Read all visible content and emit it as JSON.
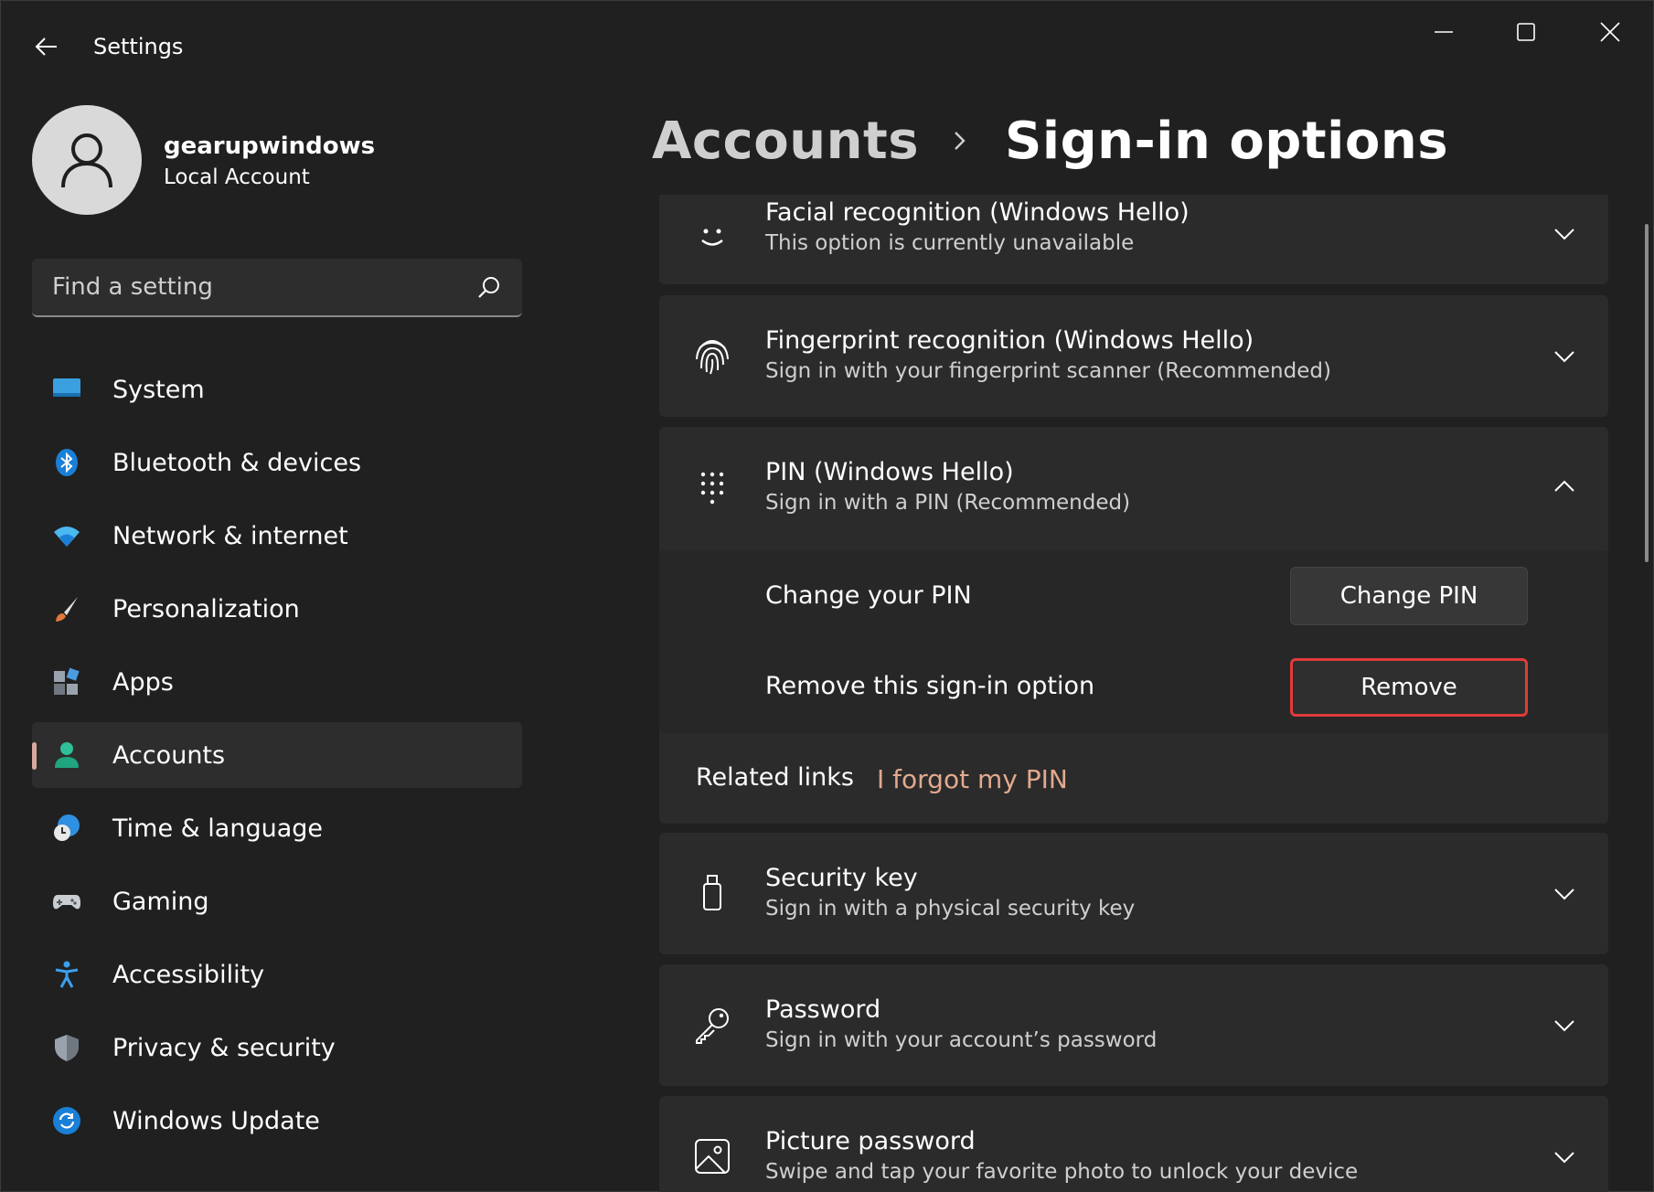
{
  "window": {
    "title": "Settings"
  },
  "user": {
    "name": "gearupwindows",
    "account_type": "Local Account"
  },
  "search": {
    "placeholder": "Find a setting"
  },
  "nav": {
    "items": [
      {
        "label": "System",
        "icon": "system-icon",
        "active": false
      },
      {
        "label": "Bluetooth & devices",
        "icon": "bluetooth-icon",
        "active": false
      },
      {
        "label": "Network & internet",
        "icon": "wifi-icon",
        "active": false
      },
      {
        "label": "Personalization",
        "icon": "brush-icon",
        "active": false
      },
      {
        "label": "Apps",
        "icon": "apps-icon",
        "active": false
      },
      {
        "label": "Accounts",
        "icon": "accounts-icon",
        "active": true
      },
      {
        "label": "Time & language",
        "icon": "time-language-icon",
        "active": false
      },
      {
        "label": "Gaming",
        "icon": "gamepad-icon",
        "active": false
      },
      {
        "label": "Accessibility",
        "icon": "accessibility-icon",
        "active": false
      },
      {
        "label": "Privacy & security",
        "icon": "shield-icon",
        "active": false
      },
      {
        "label": "Windows Update",
        "icon": "update-icon",
        "active": false
      }
    ]
  },
  "breadcrumb": {
    "parent": "Accounts",
    "current": "Sign-in options"
  },
  "options": {
    "facial": {
      "title": "Facial recognition (Windows Hello)",
      "desc": "This option is currently unavailable"
    },
    "fingerprint": {
      "title": "Fingerprint recognition (Windows Hello)",
      "desc": "Sign in with your fingerprint scanner (Recommended)"
    },
    "pin": {
      "title": "PIN (Windows Hello)",
      "desc": "Sign in with a PIN (Recommended)",
      "change_label": "Change your PIN",
      "change_button": "Change PIN",
      "remove_label": "Remove this sign-in option",
      "remove_button": "Remove",
      "related_label": "Related links",
      "related_link": "I forgot my PIN"
    },
    "security_key": {
      "title": "Security key",
      "desc": "Sign in with a physical security key"
    },
    "password": {
      "title": "Password",
      "desc": "Sign in with your account’s password"
    },
    "picture_password": {
      "title": "Picture password",
      "desc": "Swipe and tap your favorite photo to unlock your device"
    }
  },
  "colors": {
    "background": "#202020",
    "card": "#2b2b2b",
    "accent_link": "#e2a98e",
    "highlight_border": "#e23b3b"
  }
}
